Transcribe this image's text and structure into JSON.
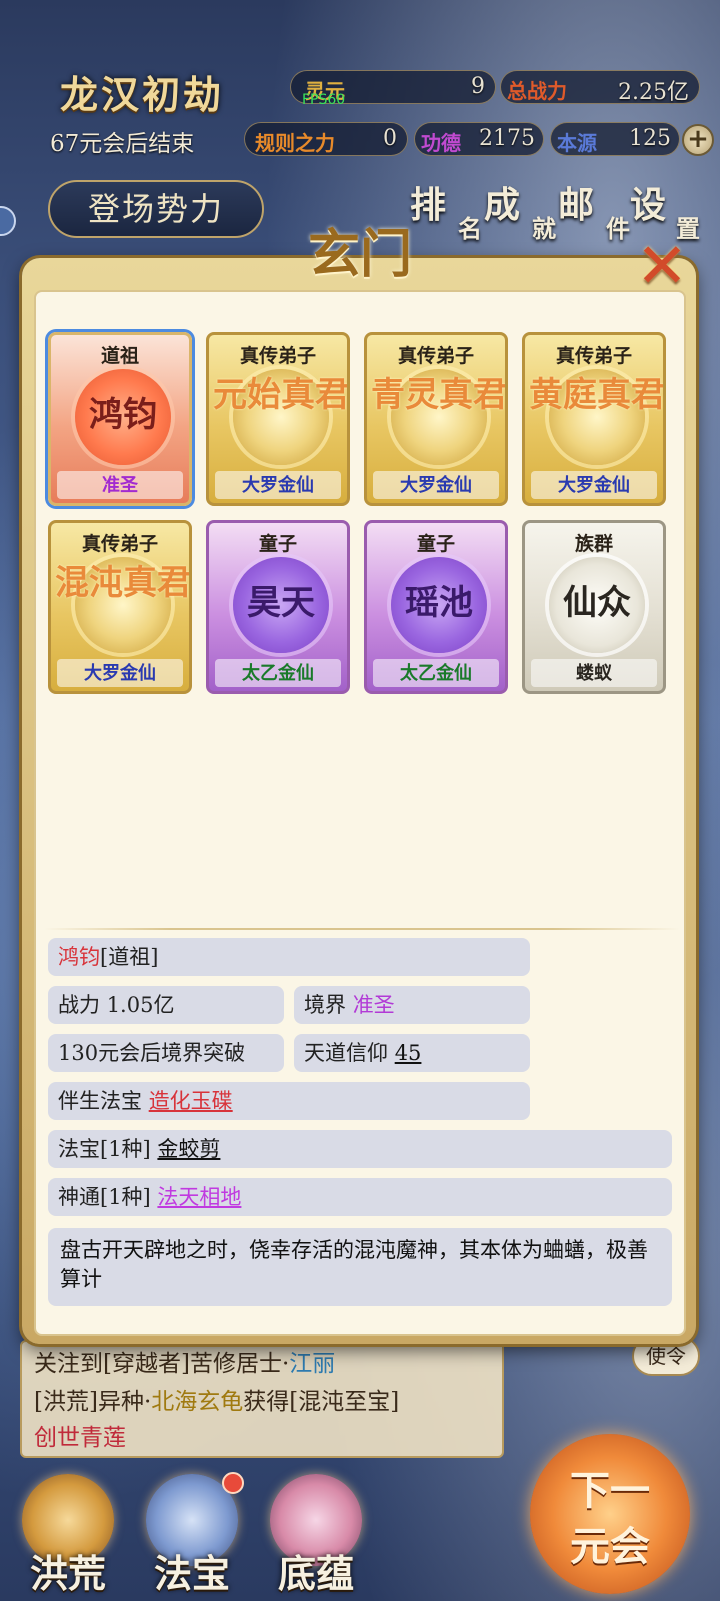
{
  "hud": {
    "title": "龙汉初劫",
    "countdown": "67元会后结束",
    "fps": "FPS60",
    "stats": [
      {
        "label": "灵元",
        "value": "9",
        "label_color": "#e0b040"
      },
      {
        "label": "总战力",
        "value": "2.25亿",
        "label_color": "#e05a2a"
      },
      {
        "label": "规则之力",
        "value": "0",
        "label_color": "#e88a2a"
      },
      {
        "label": "功德",
        "value": "2175",
        "label_color": "#c04ad0"
      },
      {
        "label": "本源",
        "value": "125",
        "label_color": "#5a7ad8"
      }
    ],
    "faction_button": "登场势力",
    "menu": [
      {
        "big": "排",
        "small": "名"
      },
      {
        "big": "成",
        "small": "就"
      },
      {
        "big": "邮",
        "small": "件"
      },
      {
        "big": "设",
        "small": "置"
      }
    ],
    "plus": "+"
  },
  "modal": {
    "title": "玄门",
    "close": "✕",
    "cards": [
      {
        "role": "道祖",
        "name": "鸿钧",
        "rank": "准圣",
        "style": "red",
        "rank_color": "#a22ad0",
        "selected": true
      },
      {
        "role": "真传弟子",
        "name": "元始真君",
        "rank": "大罗金仙",
        "style": "gold",
        "rank_color": "#2a3ab0"
      },
      {
        "role": "真传弟子",
        "name": "青灵真君",
        "rank": "大罗金仙",
        "style": "gold",
        "rank_color": "#2a3ab0"
      },
      {
        "role": "真传弟子",
        "name": "黄庭真君",
        "rank": "大罗金仙",
        "style": "gold",
        "rank_color": "#2a3ab0"
      },
      {
        "role": "真传弟子",
        "name": "混沌真君",
        "rank": "大罗金仙",
        "style": "gold",
        "rank_color": "#2a3ab0"
      },
      {
        "role": "童子",
        "name": "昊天",
        "rank": "太乙金仙",
        "style": "purple",
        "rank_color": "#1a7a2a"
      },
      {
        "role": "童子",
        "name": "瑶池",
        "rank": "太乙金仙",
        "style": "purple",
        "rank_color": "#1a7a2a"
      },
      {
        "role": "族群",
        "name": "仙众",
        "rank": "蝼蚁",
        "style": "silver",
        "rank_color": "#2a2620"
      }
    ],
    "detail": {
      "name": "鸿钧",
      "role_tag": " [道祖]",
      "power_label": "战力 ",
      "power_value": "1.05亿",
      "realm_label": "境界 ",
      "realm_value": "准圣",
      "breakthrough": "130元会后境界突破",
      "faith_label": "天道信仰 ",
      "faith_value": "45",
      "companion_label": "伴生法宝 ",
      "companion_value": "造化玉碟",
      "treasure_label": "法宝[1种] ",
      "treasure_value": "金蛟剪",
      "skill_label": "神通[1种] ",
      "skill_value": "法天相地",
      "description": "盘古开天辟地之时，侥幸存活的混沌魔神，其本体为蛐蟮，极善算计"
    }
  },
  "log": {
    "line1_prefix": "关注到[穿越者]苦修居士·",
    "line1_name": "江丽",
    "line2_a": "[洪荒]异种·",
    "line2_b": "北海玄龟",
    "line2_c": "获得[混沌至宝]",
    "line3": "创世青莲",
    "use_button": "使令"
  },
  "bottom_nav": {
    "tabs": [
      "洪荒",
      "法宝",
      "底蕴"
    ],
    "next_line1": "下一",
    "next_line2": "元会"
  }
}
